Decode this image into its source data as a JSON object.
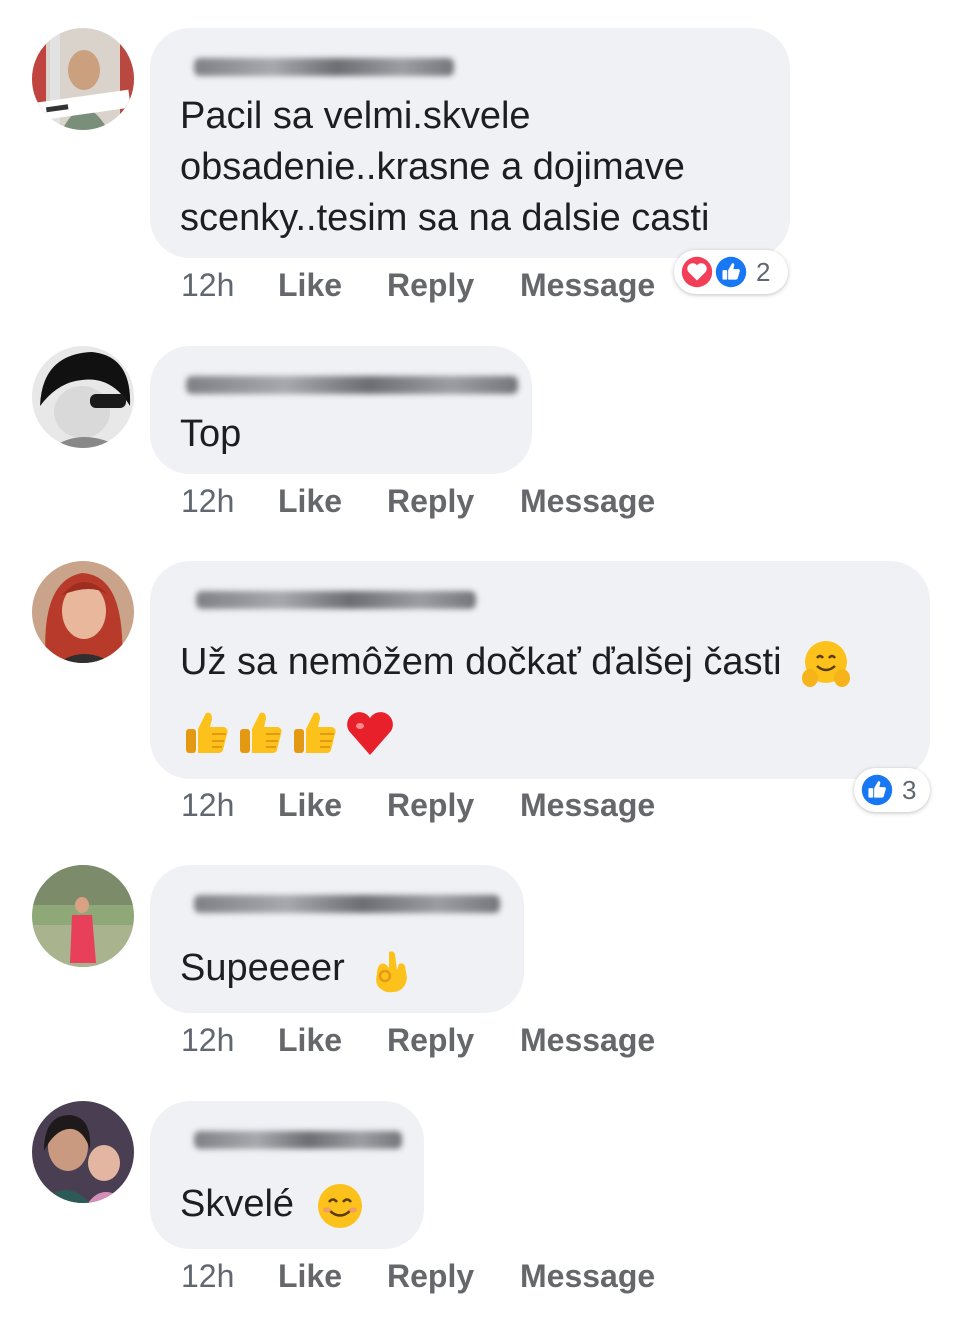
{
  "comments": [
    {
      "lines": [
        "Pacil sa velmi.skvele",
        "obsadenie..krasne a dojimave",
        "scenky..tesim sa na dalsie casti"
      ],
      "time": "12h",
      "like": "Like",
      "reply": "Reply",
      "message": "Message",
      "reactions": {
        "icons": [
          "love-icon",
          "like-icon"
        ],
        "count": "2"
      }
    },
    {
      "lines": [
        "Top"
      ],
      "time": "12h",
      "like": "Like",
      "reply": "Reply",
      "message": "Message"
    },
    {
      "lines": [
        "Už sa nemôžem dočkať ďalšej časti"
      ],
      "emoji": [
        "hugging-face-emoji",
        "thumbs-up-emoji",
        "thumbs-up-emoji",
        "thumbs-up-emoji",
        "red-heart-emoji"
      ],
      "time": "12h",
      "like": "Like",
      "reply": "Reply",
      "message": "Message",
      "reactions": {
        "icons": [
          "like-icon"
        ],
        "count": "3"
      }
    },
    {
      "lines": [
        "Supeeeer"
      ],
      "emoji": [
        "ok-hand-emoji"
      ],
      "time": "12h",
      "like": "Like",
      "reply": "Reply",
      "message": "Message"
    },
    {
      "lines": [
        "Skvelé"
      ],
      "emoji": [
        "smiling-face-emoji"
      ],
      "time": "12h",
      "like": "Like",
      "reply": "Reply",
      "message": "Message"
    }
  ],
  "colors": {
    "bubble": "#f0f1f4",
    "like_blue": "#1877f2",
    "love_red": "#f33e58",
    "action_gray": "#65676b"
  }
}
